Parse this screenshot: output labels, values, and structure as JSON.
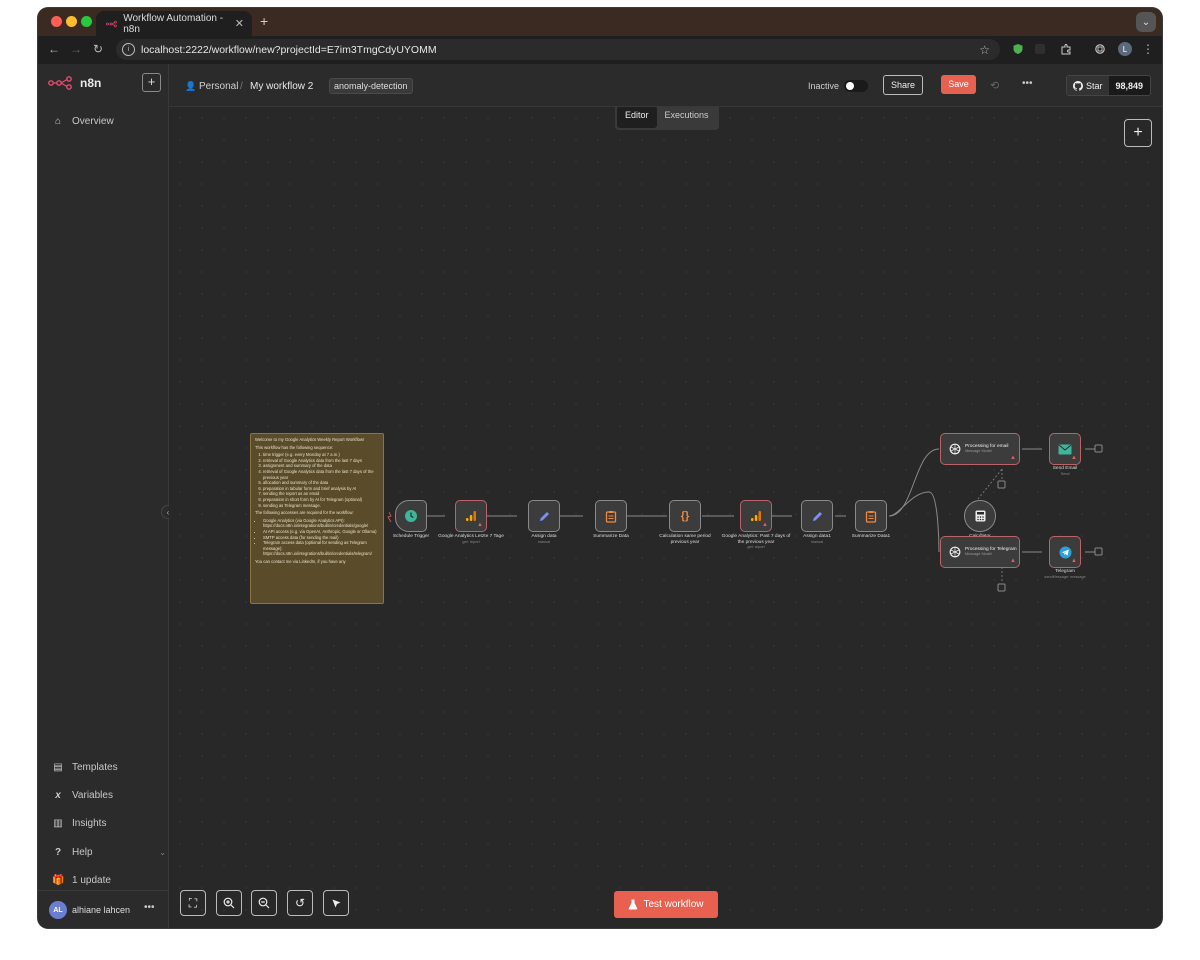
{
  "browser": {
    "tab_title": "Workflow Automation - n8n",
    "tab_close": "✕",
    "new_tab": "+",
    "url": "localhost:2222/workflow/new?projectId=E7im3TmgCdyUYOMM",
    "profile_initial": "L"
  },
  "sidebar": {
    "logo_text": "n8n",
    "add_label": "+",
    "overview": "Overview",
    "templates": "Templates",
    "variables": "Variables",
    "insights": "Insights",
    "help": "Help",
    "update": "1 update",
    "user_initials": "AL",
    "user_name": "alhiane lahcen",
    "more": "•••"
  },
  "header": {
    "project": "Personal",
    "separator": "/",
    "workflow_name": "My workflow 2",
    "tag": "anomaly-detection",
    "status_label": "Inactive",
    "share_label": "Share",
    "save_label": "Save",
    "more": "•••",
    "github_star_label": "Star",
    "github_count": "98,849"
  },
  "canvas": {
    "tabs": [
      "Editor",
      "Executions"
    ],
    "add_label": "+",
    "test_button": "Test workflow"
  },
  "sticky_note": {
    "title": "Welcome to my Google Analytics Weekly Report Workflow!",
    "intro": "This workflow has the following sequence:",
    "steps": [
      "time trigger (e.g. every Monday at 7 a.m.)",
      "retrieval of Google Analytics data from the last 7 days",
      "assignment and summary of the data",
      "retrieval of Google Analytics data from the last 7 days of the previous year",
      "allocation and summary of the data",
      "preparation in tabular form and brief analysis by AI",
      "sending the report as an email",
      "preparation in short form by AI for Telegram (optional)",
      "sending as Telegram message."
    ],
    "access_intro": "The following accesses are required for the workflow:",
    "access": [
      "Google Analytics (via Google Analytics API): https://docs.n8n.io/integrations/builtin/credentials/google/",
      "AI API access (e.g. via OpenAI, Anthropic, Google or Ollama)",
      "SMTP access data (for sending the mail)",
      "Telegram access data (optional for sending as Telegram message): https://docs.n8n.io/integrations/builtin/credentials/telegram/"
    ],
    "footer": "You can contact me via LinkedIn, if you have any"
  },
  "nodes": [
    {
      "name": "Schedule Trigger",
      "sub": ""
    },
    {
      "name": "Google Analytics Letzte 7 Tage",
      "sub": "get: report"
    },
    {
      "name": "Assign data",
      "sub": "manual"
    },
    {
      "name": "Summarize Data",
      "sub": ""
    },
    {
      "name": "Calculation same period previous year",
      "sub": ""
    },
    {
      "name": "Google Analytics: Past 7 days of the previous year",
      "sub": "get: report"
    },
    {
      "name": "Assign data1",
      "sub": "manual"
    },
    {
      "name": "Summarize Data1",
      "sub": ""
    },
    {
      "name": "Processing for email",
      "sub": "Message Model"
    },
    {
      "name": "Send Email",
      "sub": "Send"
    },
    {
      "name": "Calculator",
      "sub": ""
    },
    {
      "name": "Processing for Telegram",
      "sub": "Message Model"
    },
    {
      "name": "Telegram",
      "sub": "sendMessage: message"
    }
  ],
  "colors": {
    "accent": "#e8604f",
    "node_warning_border": "#b8646a",
    "sticky_bg": "#5a4c2b"
  }
}
